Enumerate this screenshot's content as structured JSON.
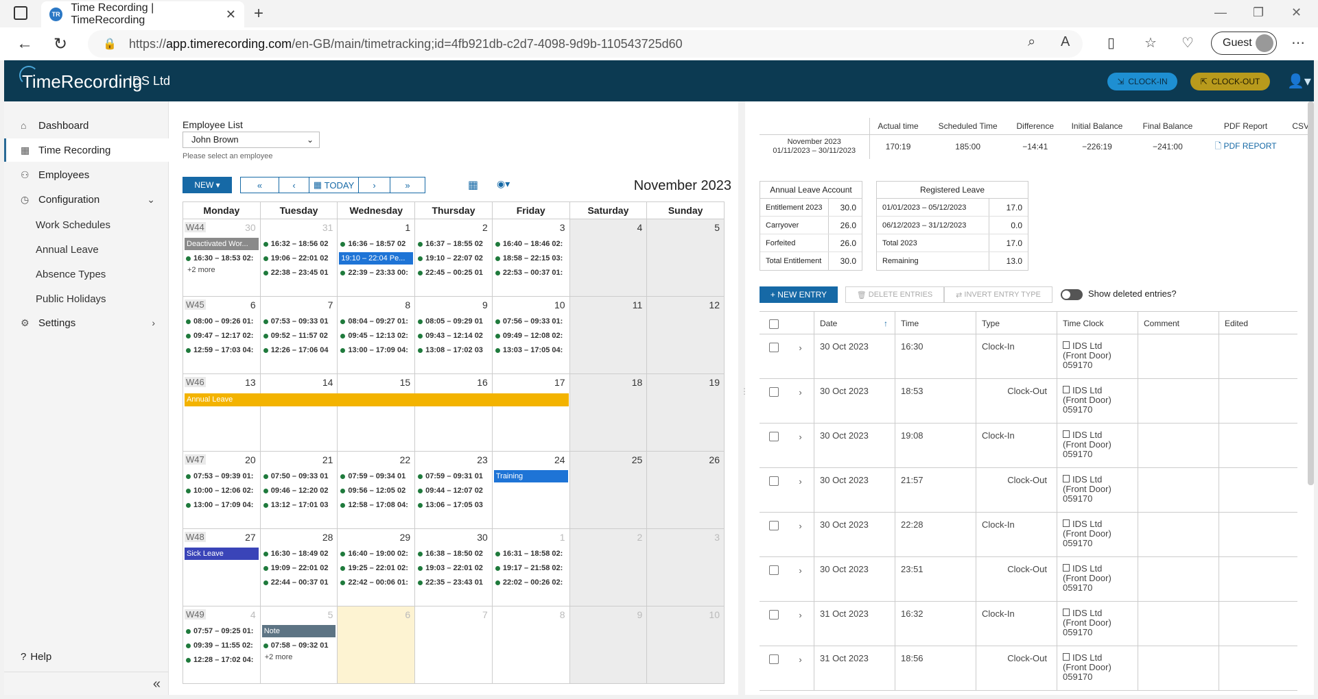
{
  "browser": {
    "tab_title": "Time Recording | TimeRecording",
    "favicon_text": "TR",
    "url_prefix": "https://",
    "url_domain": "app.timerecording.com",
    "url_path": "/en-GB/main/timetracking;id=4fb921db-c2d7-4098-9d9b-110543725d60",
    "guest_label": "Guest"
  },
  "header": {
    "logo": "TimeRecording",
    "company": "IDS Ltd",
    "clock_in": "CLOCK-IN",
    "clock_out": "CLOCK-OUT"
  },
  "sidebar": {
    "dashboard": "Dashboard",
    "time_recording": "Time Recording",
    "employees": "Employees",
    "configuration": "Configuration",
    "work_schedules": "Work Schedules",
    "annual_leave": "Annual Leave",
    "absence_types": "Absence Types",
    "public_holidays": "Public Holidays",
    "settings": "Settings",
    "help": "Help"
  },
  "calendar": {
    "employee_label": "Employee List",
    "employee_value": "John Brown",
    "employee_hint": "Please select an employee",
    "new_label": "NEW",
    "today_label": "TODAY",
    "month_title": "November 2023",
    "weekdays": [
      "Monday",
      "Tuesday",
      "Wednesday",
      "Thursday",
      "Friday",
      "Saturday",
      "Sunday"
    ],
    "weeks": [
      {
        "wk": "W44",
        "days": [
          {
            "num": "30",
            "dim": true,
            "chips": [
              {
                "text": "Deactivated Wor...",
                "color": "#8a8a8a"
              }
            ],
            "entries": [
              "16:30 – 18:53 02:"
            ],
            "more": "+2 more"
          },
          {
            "num": "31",
            "dim": true,
            "entries": [
              "16:32 – 18:56 02",
              "19:06 – 22:01 02",
              "22:38 – 23:45 01"
            ]
          },
          {
            "num": "1",
            "entries": [
              "16:36 – 18:57 02",
              "",
              "22:39 – 23:33 00:"
            ],
            "chips_mid": {
              "text": "19:10 – 22:04  Pe...",
              "color": "#1e74d6"
            }
          },
          {
            "num": "2",
            "entries": [
              "16:37 – 18:55 02",
              "19:10 – 22:07 02",
              "22:45 – 00:25 01"
            ]
          },
          {
            "num": "3",
            "entries": [
              "16:40 – 18:46 02:",
              "18:58 – 22:15 03:",
              "22:53 – 00:37 01:"
            ]
          },
          {
            "num": "4",
            "weekend": true
          },
          {
            "num": "5",
            "weekend": true
          }
        ]
      },
      {
        "wk": "W45",
        "days": [
          {
            "num": "6",
            "entries": [
              "08:00 – 09:26 01:",
              "09:47 – 12:17 02:",
              "12:59 – 17:03 04:"
            ]
          },
          {
            "num": "7",
            "entries": [
              "07:53 – 09:33 01",
              "09:52 – 11:57 02",
              "12:26 – 17:06 04"
            ]
          },
          {
            "num": "8",
            "entries": [
              "08:04 – 09:27 01:",
              "09:45 – 12:13 02:",
              "13:00 – 17:09 04:"
            ]
          },
          {
            "num": "9",
            "entries": [
              "08:05 – 09:29 01",
              "09:43 – 12:14 02",
              "13:08 – 17:02 03"
            ]
          },
          {
            "num": "10",
            "entries": [
              "07:56 – 09:33 01:",
              "09:49 – 12:08 02:",
              "13:03 – 17:05 04:"
            ]
          },
          {
            "num": "11",
            "weekend": true
          },
          {
            "num": "12",
            "weekend": true
          }
        ]
      },
      {
        "wk": "W46",
        "bar": "Annual Leave",
        "days": [
          {
            "num": "13"
          },
          {
            "num": "14"
          },
          {
            "num": "15"
          },
          {
            "num": "16"
          },
          {
            "num": "17"
          },
          {
            "num": "18",
            "weekend": true
          },
          {
            "num": "19",
            "weekend": true
          }
        ]
      },
      {
        "wk": "W47",
        "days": [
          {
            "num": "20",
            "entries": [
              "07:53 – 09:39 01:",
              "10:00 – 12:06 02:",
              "13:00 – 17:09 04:"
            ]
          },
          {
            "num": "21",
            "entries": [
              "07:50 – 09:33 01",
              "09:46 – 12:20 02",
              "13:12 – 17:01 03"
            ]
          },
          {
            "num": "22",
            "entries": [
              "07:59 – 09:34 01",
              "09:56 – 12:05 02",
              "12:58 – 17:08 04:"
            ]
          },
          {
            "num": "23",
            "entries": [
              "07:59 – 09:31 01",
              "09:44 – 12:07 02",
              "13:06 – 17:05 03"
            ]
          },
          {
            "num": "24",
            "chips": [
              {
                "text": "Training",
                "color": "#1e74d6"
              }
            ]
          },
          {
            "num": "25",
            "weekend": true
          },
          {
            "num": "26",
            "weekend": true
          }
        ]
      },
      {
        "wk": "W48",
        "days": [
          {
            "num": "27",
            "chips": [
              {
                "text": "Sick Leave",
                "color": "#3a44b8"
              }
            ]
          },
          {
            "num": "28",
            "entries": [
              "16:30 – 18:49 02",
              "19:09 – 22:01 02",
              "22:44 – 00:37 01"
            ]
          },
          {
            "num": "29",
            "entries": [
              "16:40 – 19:00 02:",
              "19:25 – 22:01 02:",
              "22:42 – 00:06 01:"
            ]
          },
          {
            "num": "30",
            "entries": [
              "16:38 – 18:50 02",
              "19:03 – 22:01 02",
              "22:35 – 23:43 01"
            ]
          },
          {
            "num": "1",
            "dim": true,
            "entries": [
              "16:31 – 18:58 02:",
              "19:17 – 21:58 02:",
              "22:02 – 00:26 02:"
            ]
          },
          {
            "num": "2",
            "dim": true,
            "weekend": true
          },
          {
            "num": "3",
            "dim": true,
            "weekend": true
          }
        ]
      },
      {
        "wk": "W49",
        "days": [
          {
            "num": "4",
            "dim": true,
            "entries": [
              "07:57 – 09:25 01:",
              "09:39 – 11:55 02:",
              "12:28 – 17:02 04:"
            ]
          },
          {
            "num": "5",
            "dim": true,
            "chips": [
              {
                "text": "Note",
                "color": "#5d7484"
              }
            ],
            "entries": [
              "07:58 – 09:32 01"
            ],
            "more": "+2 more"
          },
          {
            "num": "6",
            "dim": true,
            "today": true
          },
          {
            "num": "7",
            "dim": true
          },
          {
            "num": "8",
            "dim": true
          },
          {
            "num": "9",
            "dim": true,
            "weekend": true
          },
          {
            "num": "10",
            "dim": true,
            "weekend": true
          }
        ]
      }
    ]
  },
  "summary": {
    "headers": [
      "Actual time",
      "Scheduled Time",
      "Difference",
      "Initial Balance",
      "Final Balance",
      "PDF Report",
      "CSV"
    ],
    "period_title": "November 2023",
    "period_range": "01/11/2023 – 30/11/2023",
    "values": [
      "170:19",
      "185:00",
      "−14:41",
      "−226:19",
      "−241:00"
    ],
    "pdf_link": "PDF REPORT"
  },
  "annual_leave": {
    "title": "Annual Leave Account",
    "rows": [
      {
        "k": "Entitlement 2023",
        "v": "30.0"
      },
      {
        "k": "Carryover",
        "v": "26.0"
      },
      {
        "k": "Forfeited",
        "v": "26.0"
      },
      {
        "k": "Total Entitlement",
        "v": "30.0"
      }
    ]
  },
  "registered_leave": {
    "title": "Registered Leave",
    "rows": [
      {
        "k": "01/01/2023 – 05/12/2023",
        "v": "17.0"
      },
      {
        "k": "06/12/2023 – 31/12/2023",
        "v": "0.0"
      },
      {
        "k": "Total 2023",
        "v": "17.0"
      },
      {
        "k": "Remaining",
        "v": "13.0"
      }
    ]
  },
  "entries_toolbar": {
    "new_entry": "NEW ENTRY",
    "delete_entries": "DELETE ENTRIES",
    "invert_type": "INVERT ENTRY TYPE",
    "show_deleted": "Show deleted entries?"
  },
  "entries_table": {
    "headers": [
      "Date",
      "Time",
      "Type",
      "Time Clock",
      "Comment",
      "Edited"
    ],
    "rows": [
      {
        "date": "30 Oct 2023",
        "time": "16:30",
        "type": "Clock-In",
        "out": false,
        "clock1": "IDS Ltd",
        "clock2": "(Front Door)",
        "clock3": "059170"
      },
      {
        "date": "30 Oct 2023",
        "time": "18:53",
        "type": "Clock-Out",
        "out": true,
        "clock1": "IDS Ltd",
        "clock2": "(Front Door)",
        "clock3": "059170"
      },
      {
        "date": "30 Oct 2023",
        "time": "19:08",
        "type": "Clock-In",
        "out": false,
        "clock1": "IDS Ltd",
        "clock2": "(Front Door)",
        "clock3": "059170"
      },
      {
        "date": "30 Oct 2023",
        "time": "21:57",
        "type": "Clock-Out",
        "out": true,
        "clock1": "IDS Ltd",
        "clock2": "(Front Door)",
        "clock3": "059170"
      },
      {
        "date": "30 Oct 2023",
        "time": "22:28",
        "type": "Clock-In",
        "out": false,
        "clock1": "IDS Ltd",
        "clock2": "(Front Door)",
        "clock3": "059170"
      },
      {
        "date": "30 Oct 2023",
        "time": "23:51",
        "type": "Clock-Out",
        "out": true,
        "clock1": "IDS Ltd",
        "clock2": "(Front Door)",
        "clock3": "059170"
      },
      {
        "date": "31 Oct 2023",
        "time": "16:32",
        "type": "Clock-In",
        "out": false,
        "clock1": "IDS Ltd",
        "clock2": "(Front Door)",
        "clock3": "059170"
      },
      {
        "date": "31 Oct 2023",
        "time": "18:56",
        "type": "Clock-Out",
        "out": true,
        "clock1": "IDS Ltd",
        "clock2": "(Front Door)",
        "clock3": "059170"
      }
    ]
  },
  "colors": {
    "header_bg": "#0c3a52",
    "primary": "#1669a6",
    "clock_in": "#1e8fd2",
    "clock_out": "#b89a1c",
    "annual_leave": "#f3b300",
    "entry_dot": "#1f7a3c"
  }
}
